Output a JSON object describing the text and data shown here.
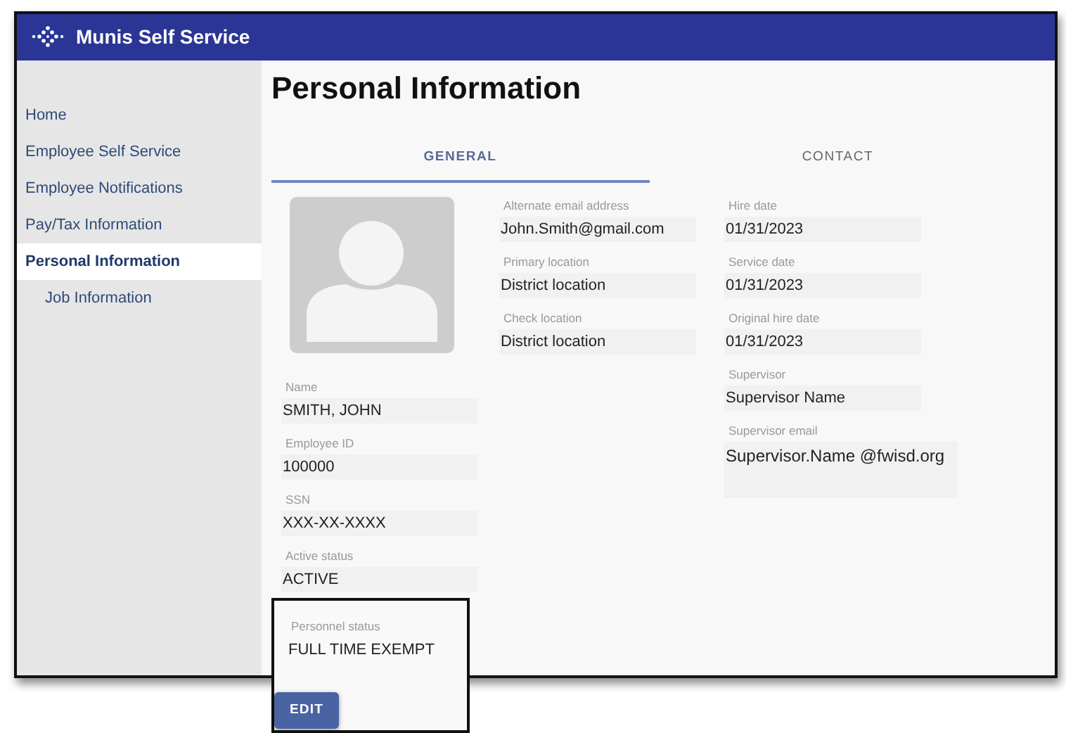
{
  "app": {
    "title": "Munis Self Service"
  },
  "sidebar": {
    "items": [
      {
        "label": "Home",
        "selected": false
      },
      {
        "label": "Employee Self Service",
        "selected": false
      },
      {
        "label": "Employee Notifications",
        "selected": false
      },
      {
        "label": "Pay/Tax Information",
        "selected": false
      },
      {
        "label": "Personal Information",
        "selected": true,
        "children": [
          {
            "label": "Job Information",
            "selected": false
          }
        ]
      }
    ]
  },
  "page": {
    "title": "Personal Information"
  },
  "tabs": [
    {
      "label": "GENERAL",
      "selected": true
    },
    {
      "label": "CONTACT",
      "selected": false
    }
  ],
  "columns": [
    {
      "fields": [
        {
          "label": "Name",
          "value": "SMITH, JOHN",
          "kind": "text"
        },
        {
          "label": "Employee ID",
          "value": "100000",
          "kind": "text"
        },
        {
          "label": "SSN",
          "value": "XXX-XX-XXXX",
          "kind": "text"
        },
        {
          "label": "Active status",
          "value": "ACTIVE",
          "kind": "text"
        }
      ]
    },
    {
      "fields": [
        {
          "label": "Alternate email address",
          "value": "John.Smith@gmail.com",
          "kind": "text"
        },
        {
          "label": "Primary location",
          "value": "District location",
          "kind": "text"
        },
        {
          "label": "Check location",
          "value": "District location",
          "kind": "text"
        }
      ]
    },
    {
      "fields": [
        {
          "label": "Hire date",
          "value": "01/31/2023",
          "kind": "text"
        },
        {
          "label": "Service date",
          "value": "01/31/2023",
          "kind": "text"
        },
        {
          "label": "Original hire date",
          "value": "01/31/2023",
          "kind": "text"
        },
        {
          "label": "Supervisor",
          "value": "Supervisor Name",
          "kind": "text"
        },
        {
          "label": "Supervisor email",
          "value": "Supervisor.Name @fwisd.org",
          "kind": "multiline"
        }
      ]
    }
  ],
  "callout": {
    "fields": [
      {
        "label": "Personnel status",
        "value": "FULL TIME EXEMPT",
        "kind": "text"
      }
    ],
    "button": "EDIT"
  }
}
